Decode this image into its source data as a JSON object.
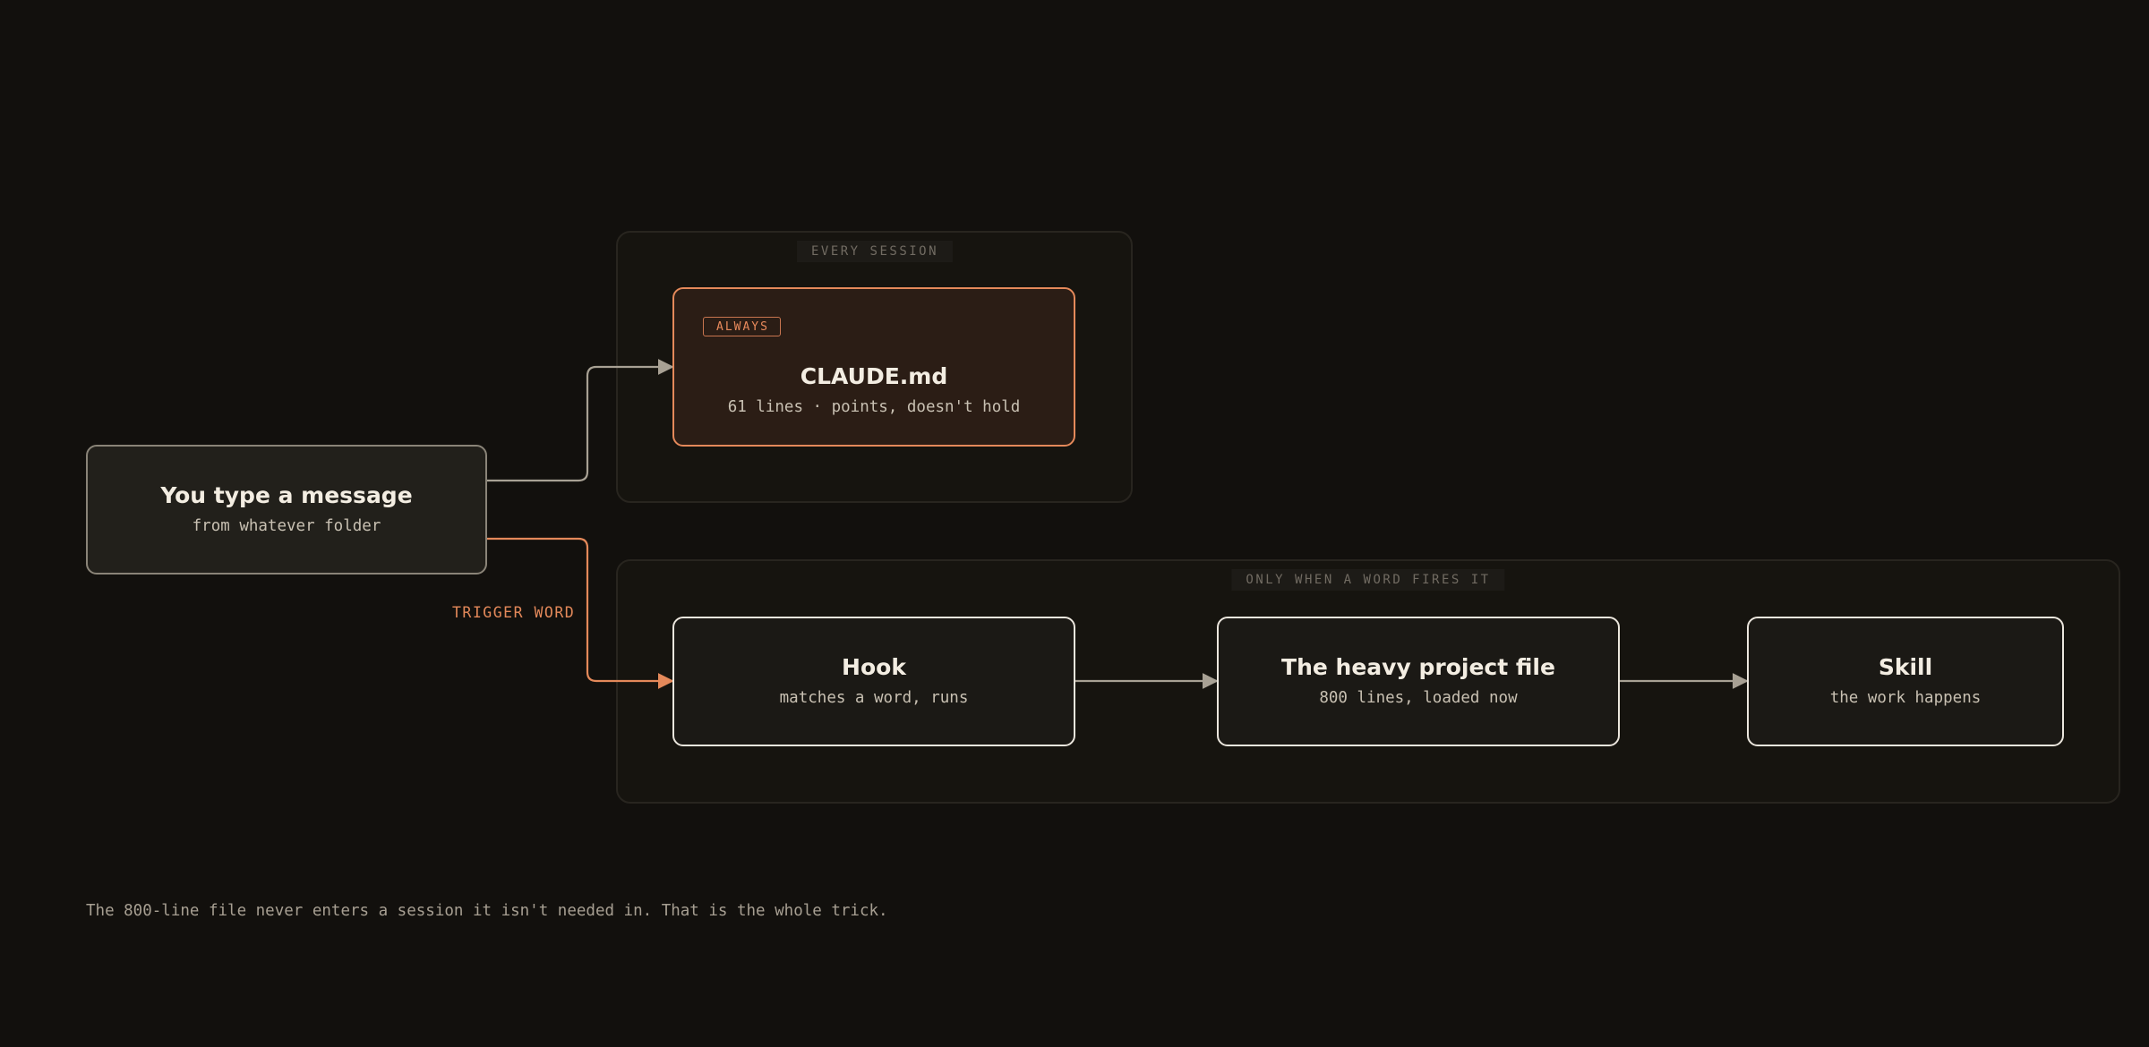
{
  "groups": {
    "every_session": {
      "label": "EVERY SESSION"
    },
    "on_trigger": {
      "label": "ONLY WHEN A WORD FIRES IT"
    }
  },
  "nodes": {
    "input": {
      "title": "You type a message",
      "subtitle": "from whatever folder"
    },
    "claude": {
      "badge": "ALWAYS",
      "title": "CLAUDE.md",
      "subtitle": "61 lines · points, doesn't hold"
    },
    "hook": {
      "title": "Hook",
      "subtitle": "matches a word, runs"
    },
    "heavy": {
      "title": "The heavy project file",
      "subtitle": "800 lines, loaded now"
    },
    "skill": {
      "title": "Skill",
      "subtitle": "the work happens"
    }
  },
  "edges": {
    "trigger_label": "TRIGGER WORD"
  },
  "footnote": "The 800-line file never enters a session it isn't needed in. That is the whole trick.",
  "colors": {
    "background": "#12100d",
    "accent": "#e4895a",
    "neutral_wire": "#a8a194",
    "node_border": "#ebe6dd"
  }
}
